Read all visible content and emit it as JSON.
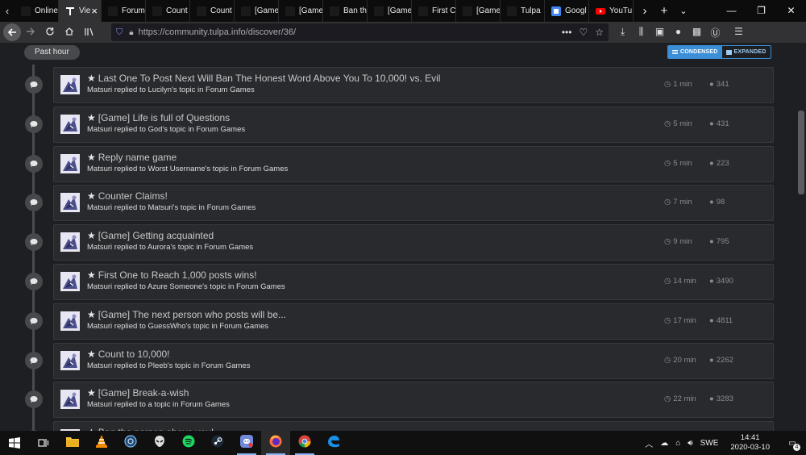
{
  "browser": {
    "tabs": [
      {
        "label": "Online",
        "icon": "tulpa-icon",
        "color": "#3b6ea8",
        "active": false
      },
      {
        "label": "Vie",
        "icon": "tulpa-t-icon",
        "color": "#ffffff",
        "active": true,
        "close": "×"
      },
      {
        "label": "Forum",
        "icon": "tulpa-icon",
        "color": "#3b6ea8",
        "active": false
      },
      {
        "label": "Count",
        "icon": "tulpa-icon",
        "color": "#3b6ea8",
        "active": false
      },
      {
        "label": "Count",
        "icon": "tulpa-icon",
        "color": "#3b6ea8",
        "active": false
      },
      {
        "label": "[Game",
        "icon": "tulpa-icon",
        "color": "#3b6ea8",
        "active": false
      },
      {
        "label": "[Game",
        "icon": "tulpa-icon",
        "color": "#3b6ea8",
        "active": false
      },
      {
        "label": "Ban th",
        "icon": "tulpa-icon",
        "color": "#3b6ea8",
        "active": false
      },
      {
        "label": "[Game",
        "icon": "tulpa-icon",
        "color": "#3b6ea8",
        "active": false
      },
      {
        "label": "First C",
        "icon": "tulpa-icon",
        "color": "#3b6ea8",
        "active": false
      },
      {
        "label": "[Game",
        "icon": "tulpa-icon",
        "color": "#3b6ea8",
        "active": false
      },
      {
        "label": "Tulpa",
        "icon": "tulpa-icon",
        "color": "#3b6ea8",
        "active": false
      },
      {
        "label": "Googl",
        "icon": "google-icon",
        "color": "#4285f4",
        "active": false
      },
      {
        "label": "YouTu",
        "icon": "youtube-icon",
        "color": "#ff0000",
        "active": false
      }
    ],
    "url": "https://community.tulpa.info/discover/36/"
  },
  "page": {
    "section_label": "Past hour",
    "view_toggle": {
      "condensed": "CONDENSED",
      "expanded": "EXPANDED"
    },
    "activity": [
      {
        "title": "Last One To Post Next Will Ban The Honest Word Above You To 10,000! vs. Evil",
        "subtitle": "Matsuri replied to Lucilyn's topic in Forum Games",
        "time": "1 min",
        "replies": "341"
      },
      {
        "title": "[Game] Life is full of Questions",
        "subtitle": "Matsuri replied to God's topic in Forum Games",
        "time": "5 min",
        "replies": "431"
      },
      {
        "title": "Reply name game",
        "subtitle": "Matsuri replied to Worst Username's topic in Forum Games",
        "time": "5 min",
        "replies": "223"
      },
      {
        "title": "Counter Claims!",
        "subtitle": "Matsuri replied to Matsuri's topic in Forum Games",
        "time": "7 min",
        "replies": "98"
      },
      {
        "title": "[Game] Getting acquainted",
        "subtitle": "Matsuri replied to Aurora's topic in Forum Games",
        "time": "9 min",
        "replies": "795"
      },
      {
        "title": "First One to Reach 1,000 posts wins!",
        "subtitle": "Matsuri replied to Azure Someone's topic in Forum Games",
        "time": "14 min",
        "replies": "3490"
      },
      {
        "title": "[Game] The next person who posts will be...",
        "subtitle": "Matsuri replied to GuessWho's topic in Forum Games",
        "time": "17 min",
        "replies": "4811"
      },
      {
        "title": "Count to 10,000!",
        "subtitle": "Matsuri replied to Pleeb's topic in Forum Games",
        "time": "20 min",
        "replies": "2262"
      },
      {
        "title": "[Game] Break-a-wish",
        "subtitle": "Matsuri replied to a topic in Forum Games",
        "time": "22 min",
        "replies": "3283"
      },
      {
        "title": "Ban the person above you!",
        "subtitle": "",
        "time": "",
        "replies": ""
      }
    ]
  },
  "taskbar": {
    "apps": [
      "file-explorer-icon",
      "vlc-icon",
      "steam-helper-icon",
      "alienware-icon",
      "spotify-icon",
      "steam-icon",
      "discord-icon",
      "firefox-icon",
      "chrome-icon",
      "edge-icon"
    ],
    "language": "SWE",
    "time": "14:41",
    "date": "2020-03-10",
    "notifications": "4"
  },
  "colors": {
    "accent": "#3b8fd6",
    "card_bg": "#292a2e",
    "page_bg": "#1e1f23"
  }
}
